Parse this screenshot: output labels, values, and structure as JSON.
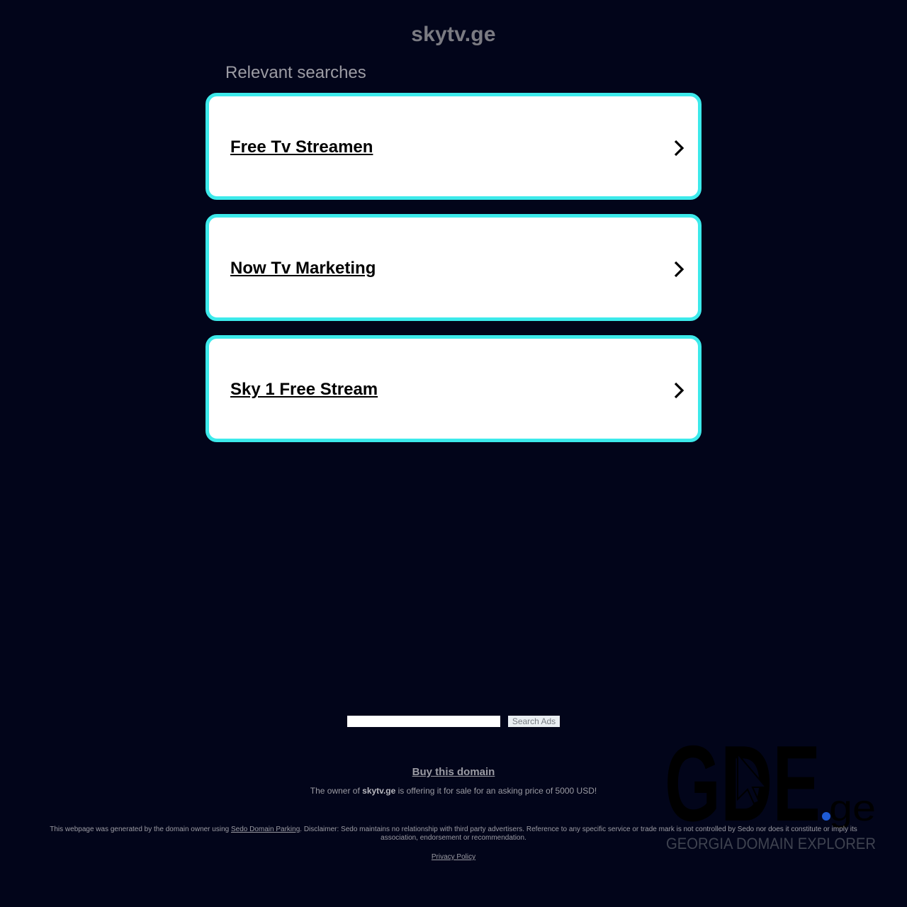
{
  "page": {
    "domain": "skytv.ge",
    "relevant_heading": "Relevant searches"
  },
  "results": [
    {
      "label": "Free Tv Streamen"
    },
    {
      "label": "Now Tv Marketing"
    },
    {
      "label": "Sky 1 Free Stream"
    }
  ],
  "search": {
    "value": "",
    "placeholder": "",
    "button_label": "Search Ads"
  },
  "sale": {
    "buy_label": "Buy this domain",
    "prefix": "The owner of ",
    "domain": "skytv.ge",
    "suffix": " is offering it for sale for an asking price of 5000 USD!"
  },
  "footer": {
    "prefix": "This webpage was generated by the domain owner using ",
    "link_label": "Sedo Domain Parking",
    "disclaimer_line1": ". Disclaimer: Sedo maintains no relationship with third party advertisers. Reference to any specific service or trade mark is not controlled by Sedo nor does it constitute or imply its",
    "disclaimer_line2": "association, endorsement or recommendation.",
    "privacy_label": "Privacy Policy"
  },
  "logo": {
    "main": "GDE",
    "tld": ".ge",
    "tagline": "GEORGIA DOMAIN EXPLORER"
  },
  "colors": {
    "background": "#02051a",
    "card_border": "#3deaeb",
    "card_background": "#ffffff",
    "logo_dot": "#1e5bd6",
    "logo_tagline": "#3f4350"
  }
}
